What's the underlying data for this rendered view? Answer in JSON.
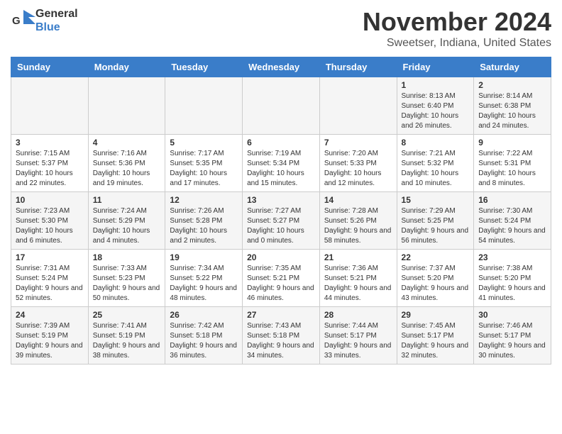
{
  "header": {
    "logo_line1": "General",
    "logo_line2": "Blue",
    "month": "November 2024",
    "location": "Sweetser, Indiana, United States"
  },
  "weekdays": [
    "Sunday",
    "Monday",
    "Tuesday",
    "Wednesday",
    "Thursday",
    "Friday",
    "Saturday"
  ],
  "weeks": [
    [
      {
        "day": "",
        "info": ""
      },
      {
        "day": "",
        "info": ""
      },
      {
        "day": "",
        "info": ""
      },
      {
        "day": "",
        "info": ""
      },
      {
        "day": "",
        "info": ""
      },
      {
        "day": "1",
        "info": "Sunrise: 8:13 AM\nSunset: 6:40 PM\nDaylight: 10 hours and 26 minutes."
      },
      {
        "day": "2",
        "info": "Sunrise: 8:14 AM\nSunset: 6:38 PM\nDaylight: 10 hours and 24 minutes."
      }
    ],
    [
      {
        "day": "3",
        "info": "Sunrise: 7:15 AM\nSunset: 5:37 PM\nDaylight: 10 hours and 22 minutes."
      },
      {
        "day": "4",
        "info": "Sunrise: 7:16 AM\nSunset: 5:36 PM\nDaylight: 10 hours and 19 minutes."
      },
      {
        "day": "5",
        "info": "Sunrise: 7:17 AM\nSunset: 5:35 PM\nDaylight: 10 hours and 17 minutes."
      },
      {
        "day": "6",
        "info": "Sunrise: 7:19 AM\nSunset: 5:34 PM\nDaylight: 10 hours and 15 minutes."
      },
      {
        "day": "7",
        "info": "Sunrise: 7:20 AM\nSunset: 5:33 PM\nDaylight: 10 hours and 12 minutes."
      },
      {
        "day": "8",
        "info": "Sunrise: 7:21 AM\nSunset: 5:32 PM\nDaylight: 10 hours and 10 minutes."
      },
      {
        "day": "9",
        "info": "Sunrise: 7:22 AM\nSunset: 5:31 PM\nDaylight: 10 hours and 8 minutes."
      }
    ],
    [
      {
        "day": "10",
        "info": "Sunrise: 7:23 AM\nSunset: 5:30 PM\nDaylight: 10 hours and 6 minutes."
      },
      {
        "day": "11",
        "info": "Sunrise: 7:24 AM\nSunset: 5:29 PM\nDaylight: 10 hours and 4 minutes."
      },
      {
        "day": "12",
        "info": "Sunrise: 7:26 AM\nSunset: 5:28 PM\nDaylight: 10 hours and 2 minutes."
      },
      {
        "day": "13",
        "info": "Sunrise: 7:27 AM\nSunset: 5:27 PM\nDaylight: 10 hours and 0 minutes."
      },
      {
        "day": "14",
        "info": "Sunrise: 7:28 AM\nSunset: 5:26 PM\nDaylight: 9 hours and 58 minutes."
      },
      {
        "day": "15",
        "info": "Sunrise: 7:29 AM\nSunset: 5:25 PM\nDaylight: 9 hours and 56 minutes."
      },
      {
        "day": "16",
        "info": "Sunrise: 7:30 AM\nSunset: 5:24 PM\nDaylight: 9 hours and 54 minutes."
      }
    ],
    [
      {
        "day": "17",
        "info": "Sunrise: 7:31 AM\nSunset: 5:24 PM\nDaylight: 9 hours and 52 minutes."
      },
      {
        "day": "18",
        "info": "Sunrise: 7:33 AM\nSunset: 5:23 PM\nDaylight: 9 hours and 50 minutes."
      },
      {
        "day": "19",
        "info": "Sunrise: 7:34 AM\nSunset: 5:22 PM\nDaylight: 9 hours and 48 minutes."
      },
      {
        "day": "20",
        "info": "Sunrise: 7:35 AM\nSunset: 5:21 PM\nDaylight: 9 hours and 46 minutes."
      },
      {
        "day": "21",
        "info": "Sunrise: 7:36 AM\nSunset: 5:21 PM\nDaylight: 9 hours and 44 minutes."
      },
      {
        "day": "22",
        "info": "Sunrise: 7:37 AM\nSunset: 5:20 PM\nDaylight: 9 hours and 43 minutes."
      },
      {
        "day": "23",
        "info": "Sunrise: 7:38 AM\nSunset: 5:20 PM\nDaylight: 9 hours and 41 minutes."
      }
    ],
    [
      {
        "day": "24",
        "info": "Sunrise: 7:39 AM\nSunset: 5:19 PM\nDaylight: 9 hours and 39 minutes."
      },
      {
        "day": "25",
        "info": "Sunrise: 7:41 AM\nSunset: 5:19 PM\nDaylight: 9 hours and 38 minutes."
      },
      {
        "day": "26",
        "info": "Sunrise: 7:42 AM\nSunset: 5:18 PM\nDaylight: 9 hours and 36 minutes."
      },
      {
        "day": "27",
        "info": "Sunrise: 7:43 AM\nSunset: 5:18 PM\nDaylight: 9 hours and 34 minutes."
      },
      {
        "day": "28",
        "info": "Sunrise: 7:44 AM\nSunset: 5:17 PM\nDaylight: 9 hours and 33 minutes."
      },
      {
        "day": "29",
        "info": "Sunrise: 7:45 AM\nSunset: 5:17 PM\nDaylight: 9 hours and 32 minutes."
      },
      {
        "day": "30",
        "info": "Sunrise: 7:46 AM\nSunset: 5:17 PM\nDaylight: 9 hours and 30 minutes."
      }
    ]
  ]
}
